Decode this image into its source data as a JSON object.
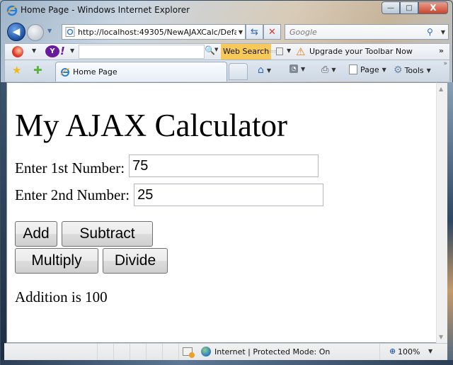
{
  "window": {
    "title": "Home Page - Windows Internet Explorer",
    "caption_buttons": {
      "minimize": "—",
      "maximize": "□",
      "close": "X"
    }
  },
  "nav": {
    "address": "http://localhost:49305/NewAJAXCalc/Defa",
    "search_placeholder": "Google"
  },
  "yahoo_toolbar": {
    "logo_text": "Y",
    "logo_excl": "!",
    "web_search_label": "Web Search",
    "upgrade_label": "Upgrade your Toolbar Now",
    "more": "»"
  },
  "tabs": [
    {
      "label": "Home Page",
      "active": true
    }
  ],
  "command_bar": {
    "page_label": "Page",
    "tools_label": "Tools"
  },
  "page": {
    "title": "My AJAX Calculator",
    "first_label": "Enter 1st Number:",
    "first_value": "75",
    "second_label": "Enter 2nd Number:",
    "second_value": "25",
    "buttons": {
      "add": "Add",
      "subtract": "Subtract",
      "multiply": "Multiply",
      "divide": "Divide"
    },
    "result": "Addition is 100"
  },
  "status_bar": {
    "zone": "Internet | Protected Mode: On",
    "zoom": "100%"
  }
}
